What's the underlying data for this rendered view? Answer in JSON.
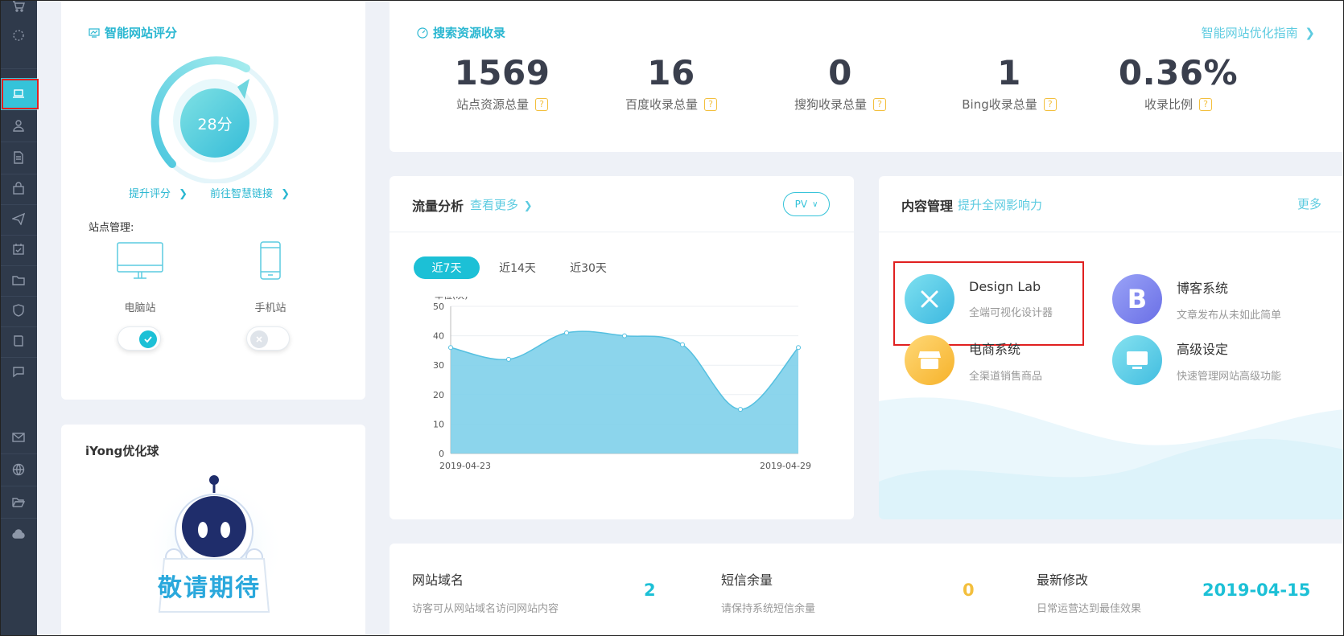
{
  "sidebar": {
    "items": [
      {
        "icon": "cart-icon"
      },
      {
        "icon": "loading-icon"
      },
      {
        "icon": "laptop-icon",
        "active": true
      },
      {
        "icon": "user-icon"
      },
      {
        "icon": "document-icon"
      },
      {
        "icon": "bag-icon"
      },
      {
        "icon": "paper-plane-icon"
      },
      {
        "icon": "calendar-check-icon"
      },
      {
        "icon": "folder-icon"
      },
      {
        "icon": "shield-icon"
      },
      {
        "icon": "book-icon"
      },
      {
        "icon": "chat-icon"
      },
      {
        "icon": "mail-icon"
      },
      {
        "icon": "globe-icon"
      },
      {
        "icon": "folder-open-icon"
      },
      {
        "icon": "cloud-icon"
      }
    ]
  },
  "score": {
    "title": "智能网站评分",
    "value": "28分",
    "level": 0.28,
    "improve_link": "提升评分",
    "smart_link": "前往智慧链接",
    "site_label": "站点管理:",
    "pc_label": "电脑站",
    "mobile_label": "手机站",
    "pc_enabled": true,
    "mobile_enabled": false
  },
  "robot": {
    "title": "iYong优化球",
    "coming_soon": "敬请期待"
  },
  "search": {
    "title": "搜索资源收录",
    "guide_link": "智能网站优化指南",
    "metrics": [
      {
        "value": "1569",
        "label": "站点资源总量"
      },
      {
        "value": "16",
        "label": "百度收录总量"
      },
      {
        "value": "0",
        "label": "搜狗收录总量"
      },
      {
        "value": "1",
        "label": "Bing收录总量"
      },
      {
        "value": "0.36%",
        "label": "收录比例"
      }
    ]
  },
  "traffic": {
    "title": "流量分析",
    "more_link": "查看更多",
    "pv_label": "PV",
    "tabs": [
      "近7天",
      "近14天",
      "近30天"
    ],
    "active_tab": 0
  },
  "chart_data": {
    "type": "area",
    "ylabel": "单位(次)",
    "ylim": [
      0,
      50
    ],
    "yticks": [
      0,
      10,
      20,
      30,
      40,
      50
    ],
    "x": [
      "2019-04-23",
      "2019-04-24",
      "2019-04-25",
      "2019-04-26",
      "2019-04-27",
      "2019-04-28",
      "2019-04-29"
    ],
    "x_labels_shown": [
      "2019-04-23",
      "2019-04-29"
    ],
    "series": [
      {
        "values": [
          36,
          32,
          41,
          40,
          37,
          15,
          36
        ]
      }
    ],
    "grid": true,
    "color": "#7fd0ea"
  },
  "content": {
    "title": "内容管理",
    "subtitle_link": "提升全网影响力",
    "more": "更多",
    "modules": [
      {
        "name": "Design Lab",
        "desc": "全端可视化设计器",
        "icon": "pencil-ruler-icon"
      },
      {
        "name": "博客系统",
        "desc": "文章发布从未如此简单",
        "icon": "letter-b-icon"
      },
      {
        "name": "电商系统",
        "desc": "全渠道销售商品",
        "icon": "shop-icon"
      },
      {
        "name": "高级设定",
        "desc": "快速管理网站高级功能",
        "icon": "monitor-icon"
      }
    ]
  },
  "info": {
    "domain_title": "网站域名",
    "domain_desc": "访客可从网站域名访问网站内容",
    "domain_value": "2",
    "sms_title": "短信余量",
    "sms_desc": "请保持系统短信余量",
    "sms_value": "0",
    "modified_title": "最新修改",
    "modified_desc": "日常运营达到最佳效果",
    "modified_value": "2019-04-15"
  },
  "colors": {
    "accent": "#35c3d9",
    "sidebar": "#2f3a4b",
    "warning": "#f3bf3d",
    "highlight": "#e02020"
  }
}
